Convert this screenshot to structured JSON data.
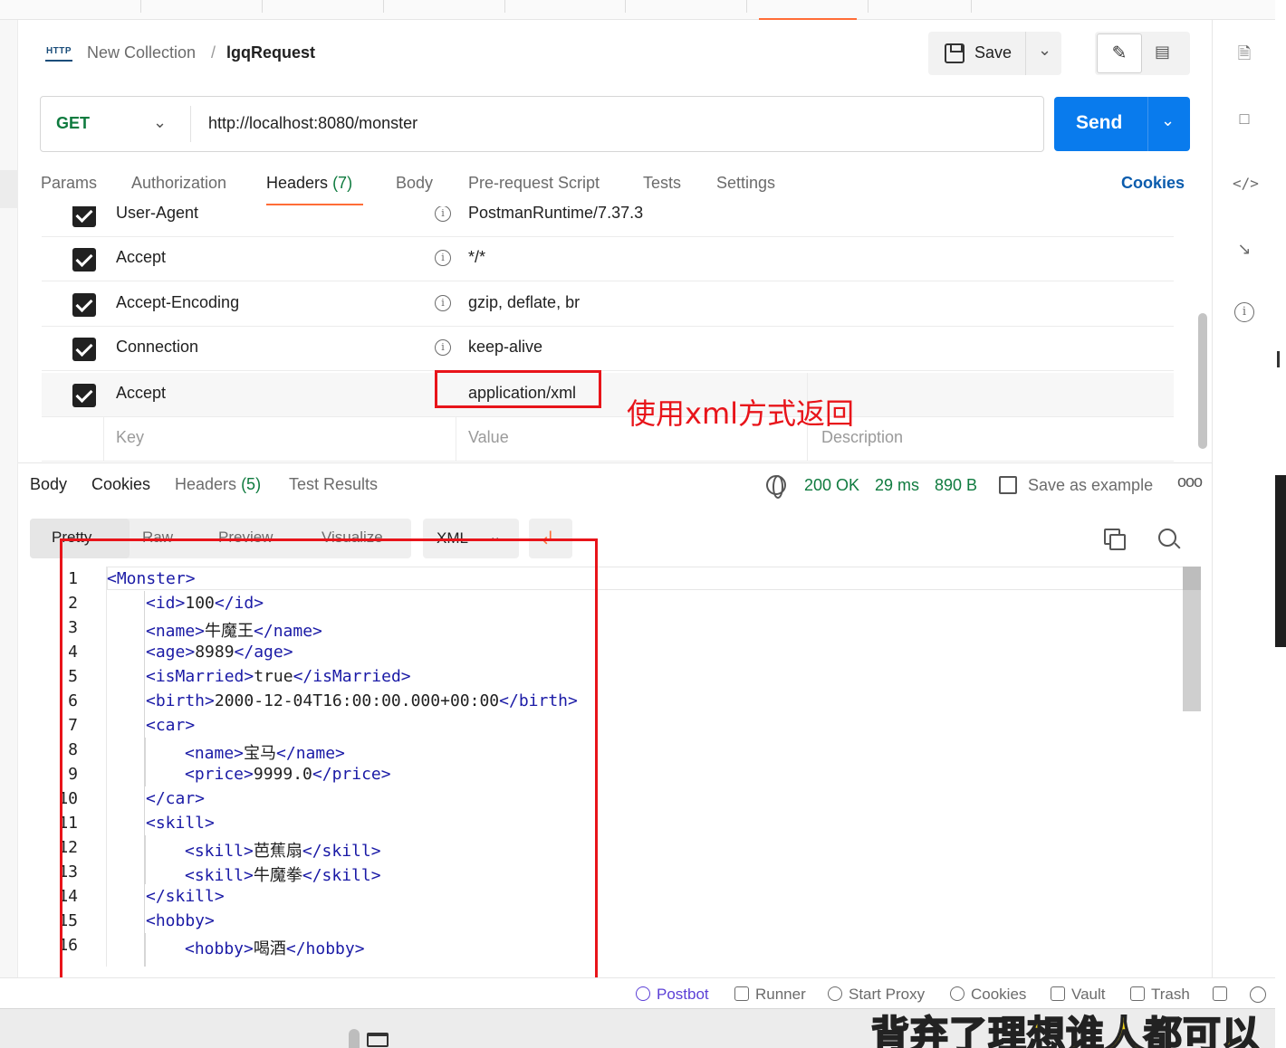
{
  "breadcrumb": {
    "icon": "HTTP",
    "collection": "New Collection",
    "separator": "/",
    "request": "lgqRequest"
  },
  "toolbar": {
    "save_label": "Save"
  },
  "request": {
    "method": "GET",
    "url": "http://localhost:8080/monster",
    "send_label": "Send"
  },
  "request_tabs": [
    {
      "label": "Params"
    },
    {
      "label": "Authorization"
    },
    {
      "label": "Headers",
      "count": "(7)"
    },
    {
      "label": "Body"
    },
    {
      "label": "Pre-request Script"
    },
    {
      "label": "Tests"
    },
    {
      "label": "Settings"
    }
  ],
  "cookies_link": "Cookies",
  "headers": [
    {
      "key": "User-Agent",
      "value": "PostmanRuntime/7.37.3",
      "checked": true
    },
    {
      "key": "Accept",
      "value": "*/*",
      "checked": true
    },
    {
      "key": "Accept-Encoding",
      "value": "gzip, deflate, br",
      "checked": true
    },
    {
      "key": "Connection",
      "value": "keep-alive",
      "checked": true
    },
    {
      "key": "Accept",
      "value": "application/xml",
      "checked": true
    }
  ],
  "header_placeholders": {
    "key": "Key",
    "value": "Value",
    "description": "Description"
  },
  "annotation": "使用xml方式返回",
  "response_tabs": [
    {
      "label": "Body"
    },
    {
      "label": "Cookies"
    },
    {
      "label": "Headers",
      "count": "(5)"
    },
    {
      "label": "Test Results"
    }
  ],
  "response_meta": {
    "status": "200 OK",
    "time": "29 ms",
    "size": "890 B",
    "save_example": "Save as example",
    "more": "ooo"
  },
  "view_modes": [
    "Pretty",
    "Raw",
    "Preview",
    "Visualize"
  ],
  "format": "XML",
  "code_lines": [
    {
      "n": "1",
      "indent": 0,
      "open": "<Monster>",
      "text": "",
      "close": ""
    },
    {
      "n": "2",
      "indent": 1,
      "open": "<id>",
      "text": "100",
      "close": "</id>"
    },
    {
      "n": "3",
      "indent": 1,
      "open": "<name>",
      "text": "牛魔王",
      "close": "</name>"
    },
    {
      "n": "4",
      "indent": 1,
      "open": "<age>",
      "text": "8989",
      "close": "</age>"
    },
    {
      "n": "5",
      "indent": 1,
      "open": "<isMarried>",
      "text": "true",
      "close": "</isMarried>"
    },
    {
      "n": "6",
      "indent": 1,
      "open": "<birth>",
      "text": "2000-12-04T16:00:00.000+00:00",
      "close": "</birth>"
    },
    {
      "n": "7",
      "indent": 1,
      "open": "<car>",
      "text": "",
      "close": ""
    },
    {
      "n": "8",
      "indent": 2,
      "open": "<name>",
      "text": "宝马",
      "close": "</name>"
    },
    {
      "n": "9",
      "indent": 2,
      "open": "<price>",
      "text": "9999.0",
      "close": "</price>"
    },
    {
      "n": "10",
      "indent": 1,
      "open": "</car>",
      "text": "",
      "close": ""
    },
    {
      "n": "11",
      "indent": 1,
      "open": "<skill>",
      "text": "",
      "close": ""
    },
    {
      "n": "12",
      "indent": 2,
      "open": "<skill>",
      "text": "芭蕉扇",
      "close": "</skill>"
    },
    {
      "n": "13",
      "indent": 2,
      "open": "<skill>",
      "text": "牛魔拳",
      "close": "</skill>"
    },
    {
      "n": "14",
      "indent": 1,
      "open": "</skill>",
      "text": "",
      "close": ""
    },
    {
      "n": "15",
      "indent": 1,
      "open": "<hobby>",
      "text": "",
      "close": ""
    },
    {
      "n": "16",
      "indent": 2,
      "open": "<hobby>",
      "text": "喝酒",
      "close": "</hobby>"
    }
  ],
  "status_bar": [
    {
      "label": "Postbot",
      "icon": "postbot-icon"
    },
    {
      "label": "Runner",
      "icon": "runner-icon"
    },
    {
      "label": "Start Proxy",
      "icon": "proxy-icon"
    },
    {
      "label": "Cookies",
      "icon": "cookie-icon"
    },
    {
      "label": "Vault",
      "icon": "vault-icon"
    },
    {
      "label": "Trash",
      "icon": "trash-icon"
    }
  ],
  "watermark": "背弃了理想谁人都可以",
  "colors": {
    "accent": "#ff6c37",
    "send": "#097bed",
    "method_get": "#0f7b3f",
    "annotation": "#e8141a",
    "xml_tag": "#1a1aa6"
  }
}
